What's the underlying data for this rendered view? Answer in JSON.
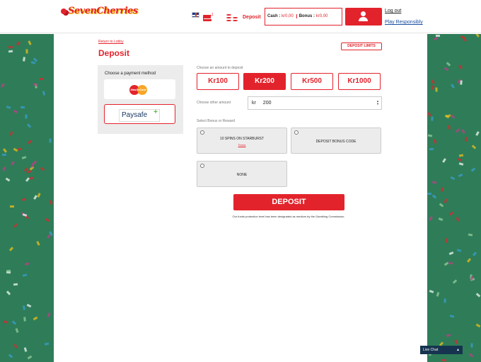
{
  "header": {
    "logo_text": "SevenCherries",
    "mail_count": "1",
    "deposit_label": "Deposit",
    "cash_label": "Cash :",
    "cash_value": "kr0,00",
    "bonus_label": "Bonus :",
    "bonus_value": "kr0,00",
    "logout_label": "Log out",
    "play_responsibly_label": "Play Responsibly"
  },
  "deposit_page": {
    "return_link": "Return to Lobby",
    "title": "Deposit",
    "limits_button": "DEPOSIT LIMITS",
    "payment_method_title": "Choose a payment method",
    "payment_methods": [
      {
        "name": "MasterCard",
        "selected": false
      },
      {
        "name": "Paysafe",
        "selected": true
      }
    ],
    "choose_amount_label": "Choose an amount to deposit",
    "amounts": [
      {
        "label": "Kr100",
        "selected": false
      },
      {
        "label": "Kr200",
        "selected": true
      },
      {
        "label": "Kr500",
        "selected": false
      },
      {
        "label": "Kr1000",
        "selected": false
      }
    ],
    "other_amount_label": "Choose other amount",
    "currency_prefix": "kr",
    "amount_value": "200",
    "bonus_label": "Select Bonus or Reward",
    "bonus_options": [
      {
        "label": "10 SPINS ON STARBURST",
        "link": "Terms"
      },
      {
        "label": "DEPOSIT BONUS CODE"
      },
      {
        "label": "NONE"
      }
    ],
    "deposit_button": "DEPOSIT",
    "notice": "Our funds protection level has been designated as medium by the Gambling Commission."
  },
  "livechat": {
    "label": "Live Chat",
    "arrow": "▲"
  },
  "colors": {
    "accent": "#e3232c",
    "background_green": "#2e7d58"
  }
}
